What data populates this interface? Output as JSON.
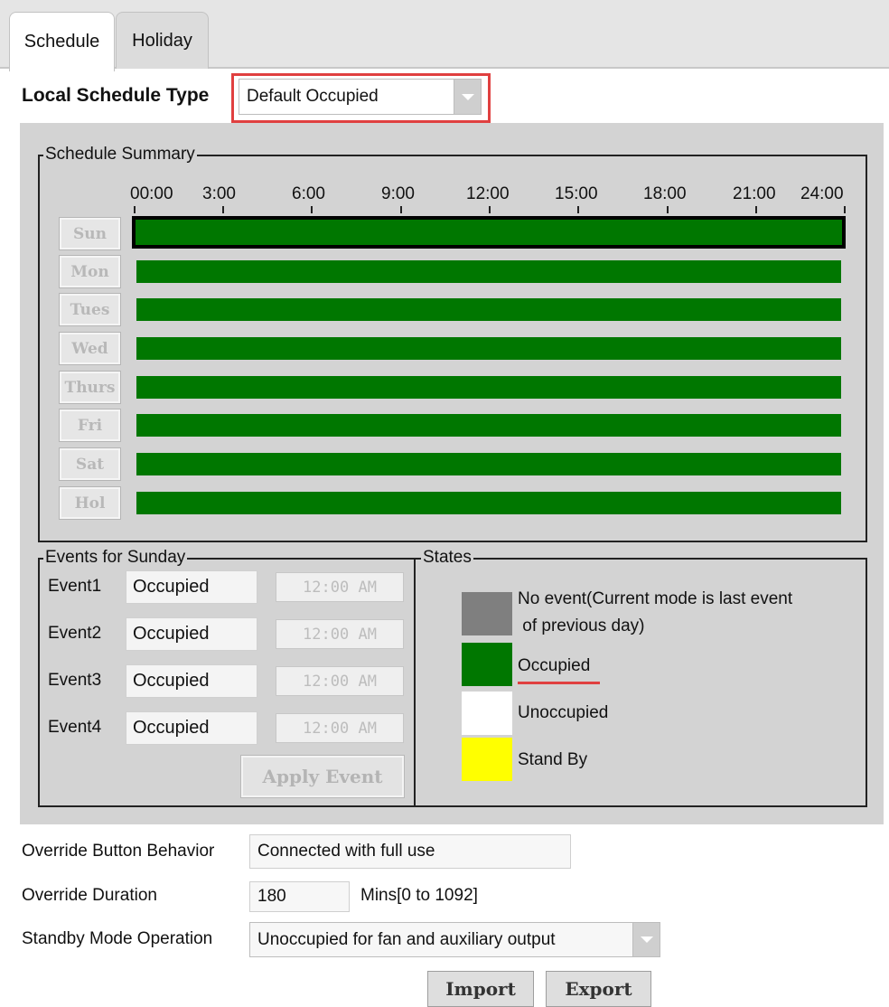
{
  "tabs": [
    {
      "label": "Schedule",
      "active": true
    },
    {
      "label": "Holiday",
      "active": false
    }
  ],
  "local_schedule": {
    "label": "Local Schedule Type",
    "value": "Default Occupied",
    "highlight_color": "#e04040"
  },
  "schedule_summary": {
    "title": "Schedule Summary",
    "times": [
      "00:00",
      "3:00",
      "6:00",
      "9:00",
      "12:00",
      "15:00",
      "18:00",
      "21:00",
      "24:00"
    ],
    "days": [
      {
        "label": "Sun",
        "state": "Occupied",
        "selected": true
      },
      {
        "label": "Mon",
        "state": "Occupied"
      },
      {
        "label": "Tues",
        "state": "Occupied"
      },
      {
        "label": "Wed",
        "state": "Occupied"
      },
      {
        "label": "Thurs",
        "state": "Occupied"
      },
      {
        "label": "Fri",
        "state": "Occupied"
      },
      {
        "label": "Sat",
        "state": "Occupied"
      },
      {
        "label": "Hol",
        "state": "Occupied"
      }
    ],
    "occupied_color": "#007700"
  },
  "events": {
    "title": "Events for Sunday",
    "rows": [
      {
        "label": "Event1",
        "state": "Occupied",
        "time": "12:00 AM"
      },
      {
        "label": "Event2",
        "state": "Occupied",
        "time": "12:00 AM"
      },
      {
        "label": "Event3",
        "state": "Occupied",
        "time": "12:00 AM"
      },
      {
        "label": "Event4",
        "state": "Occupied",
        "time": "12:00 AM"
      }
    ],
    "apply_label": "Apply Event"
  },
  "states": {
    "title": "States",
    "items": [
      {
        "label": "No event(Current mode is last event",
        "label2": " of previous day)",
        "color": "#7f7f7f"
      },
      {
        "label": "Occupied",
        "color": "#007700",
        "underline_color": "#e04040"
      },
      {
        "label": "Unoccupied",
        "color": "#ffffff"
      },
      {
        "label": "Stand By",
        "color": "#ffff00"
      }
    ]
  },
  "override": {
    "behavior_label": "Override Button Behavior",
    "behavior_value": "Connected with full use",
    "duration_label": "Override Duration",
    "duration_value": "180",
    "duration_unit": "Mins[0 to 1092]",
    "standby_label": "Standby Mode Operation",
    "standby_value": "Unoccupied for fan and auxiliary output"
  },
  "actions": {
    "import_label": "Import",
    "export_label": "Export"
  }
}
